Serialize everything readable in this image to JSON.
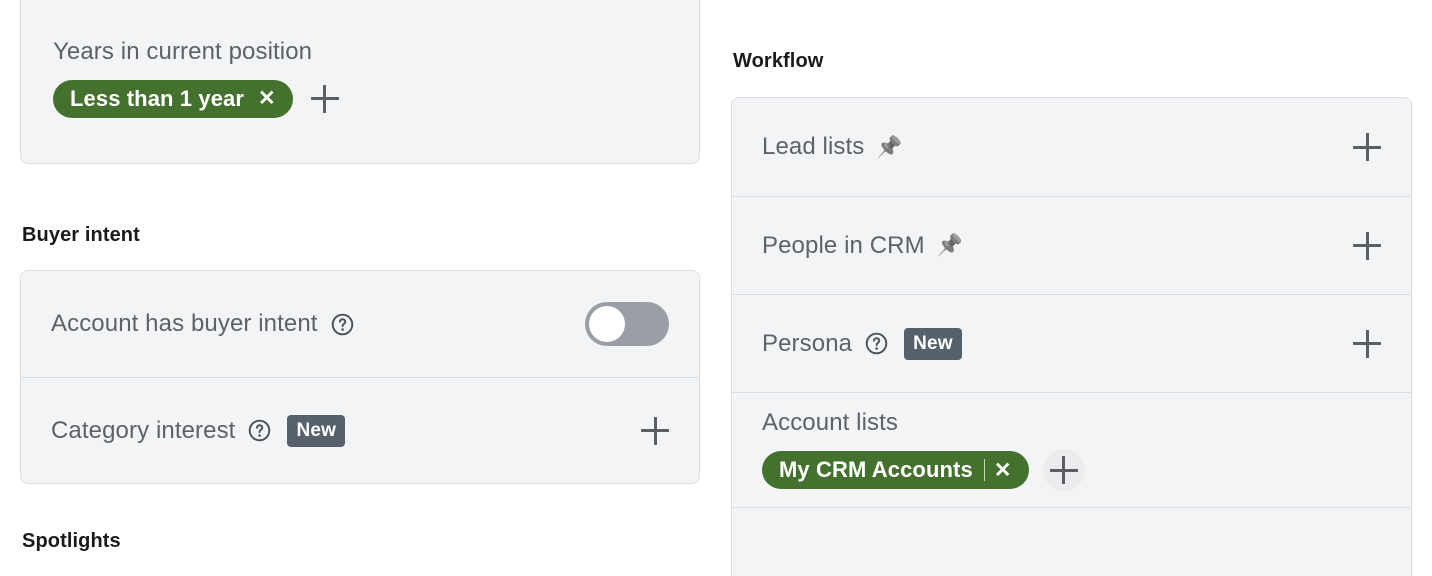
{
  "left_column": {
    "years_panel": {
      "label": "Years in current position",
      "chips": [
        {
          "text": "Less than 1 year",
          "remove_icon": "✕"
        }
      ],
      "add_icon": "plus-icon"
    },
    "buyer_intent_heading": "Buyer intent",
    "buyer_intent_rows": [
      {
        "label": "Account has buyer intent",
        "help_icon": "question-circle-icon",
        "control": "toggle",
        "toggle_state": "off"
      },
      {
        "label": "Category interest",
        "help_icon": "question-circle-icon",
        "badge": "New",
        "control": "plus"
      }
    ],
    "spotlights_heading": "Spotlights"
  },
  "right_column": {
    "workflow_heading": "Workflow",
    "workflow_rows": [
      {
        "label": "Lead lists",
        "pin_icon": "📌",
        "control": "plus"
      },
      {
        "label": "People in CRM",
        "pin_icon": "📌",
        "control": "plus"
      },
      {
        "label": "Persona",
        "help_icon": "question-circle-icon",
        "badge": "New",
        "control": "plus"
      },
      {
        "label": "Account lists",
        "chips": [
          {
            "text": "My CRM Accounts",
            "remove_icon": "✕"
          }
        ],
        "control": "plus-circle"
      }
    ]
  },
  "colors": {
    "chip_green": "#44712e",
    "badge_slate": "#56616c",
    "panel_bg": "#f3f4f6",
    "panel_border": "#dcdfe3",
    "label_gray": "#5e6266",
    "icon_gray": "#5b5e62",
    "toggle_track_off": "#9a9fa5"
  }
}
